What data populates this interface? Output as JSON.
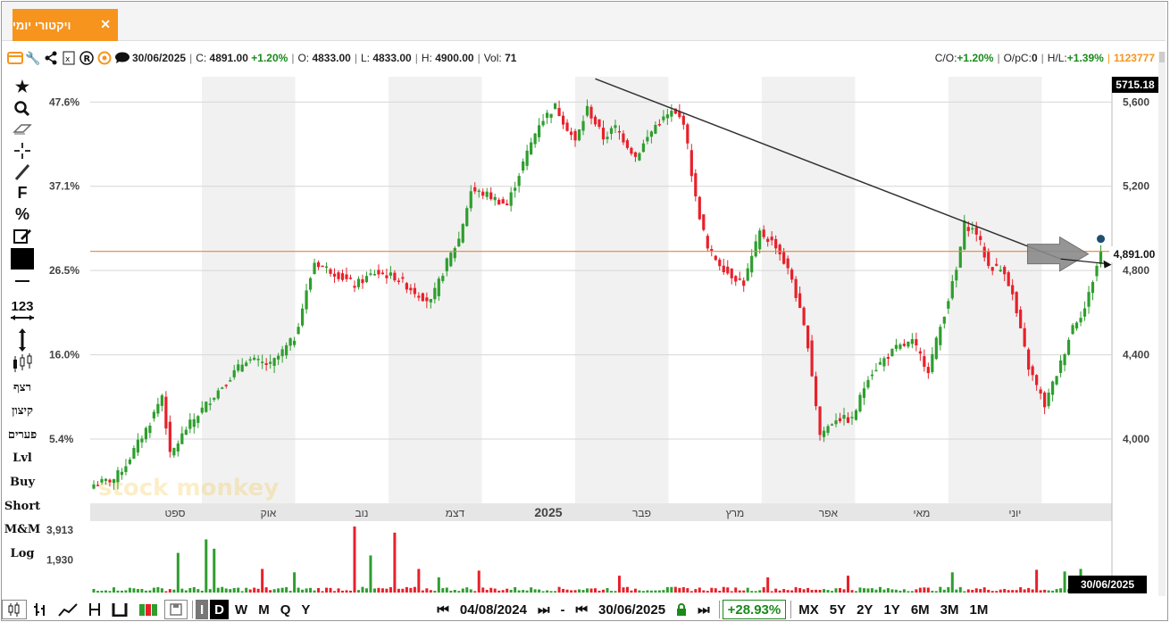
{
  "tab": {
    "name": "ויקטורי יומי",
    "close": "✕"
  },
  "info": {
    "date": "30/06/2025",
    "close_label": "C:",
    "close": "4891.00",
    "change": "+1.20%",
    "open_label": "O:",
    "open": "4833.00",
    "low_label": "L:",
    "low": "4833.00",
    "high_label": "H:",
    "high": "4900.00",
    "vol_label": "Vol:",
    "vol": "71",
    "co_label": "C/O:",
    "co": "+1.20%",
    "opc_label": "O/pC:",
    "opc": "0",
    "hl_label": "H/L:",
    "hl": "+1.39%",
    "id": "1123777"
  },
  "sidebar": {
    "tools": [
      "★",
      "🔍",
      "⌫",
      "┼",
      "╱",
      "F",
      "%",
      "✎"
    ],
    "labels": [
      "123",
      "רצף",
      "קיצון",
      "פערים",
      "Lvl",
      "Buy",
      "Short",
      "M&M",
      "Log"
    ]
  },
  "badges": {
    "last": "5715.18",
    "price": "4,891.00",
    "date": "30/06/2025"
  },
  "bottom": {
    "buttons": [
      "I",
      "D",
      "W",
      "M",
      "Q",
      "Y"
    ],
    "from_date": "04/08/2024",
    "dash": "-",
    "to_date": "30/06/2025",
    "return": "+28.93%",
    "ranges": [
      "MX",
      "5Y",
      "2Y",
      "1Y",
      "6M",
      "3M",
      "1M"
    ]
  },
  "colors": {
    "up": "#2e9e2e",
    "down": "#e8202a",
    "accent": "#f7941d",
    "trend": "#333333",
    "hline": "#e08a3a"
  },
  "watermark": "stock monkey",
  "chart_data": {
    "type": "candlestick",
    "x_range": [
      "04/08/2024",
      "30/06/2025"
    ],
    "month_labels": [
      "ספט",
      "אוק",
      "נוב",
      "דצמ",
      "2025",
      "פבר",
      "מרץ",
      "אפר",
      "מאי",
      "יוני"
    ],
    "price_axis": {
      "ticks": [
        5600,
        5200,
        4800,
        4400,
        4000
      ],
      "tick_labels": [
        "5,600",
        "5,200",
        "4,800",
        "4,400",
        "4,000"
      ],
      "range": [
        3695,
        5720
      ]
    },
    "pct_axis": {
      "tick_labels": [
        "47.6%",
        "37.1%",
        "26.5%",
        "16.0%",
        "5.4%"
      ]
    },
    "volume_axis": {
      "tick_labels": [
        "3,913",
        "1,930"
      ],
      "max": 3913
    },
    "last_price": 4891,
    "hline": 4891,
    "trendline": {
      "from": {
        "index": 125,
        "price": 5710
      },
      "to": {
        "index": 241,
        "price": 4855
      }
    },
    "anchors": [
      [
        0,
        3785
      ],
      [
        5,
        3810
      ],
      [
        8,
        3880
      ],
      [
        14,
        4080
      ],
      [
        17,
        4210
      ],
      [
        19,
        3920
      ],
      [
        23,
        4050
      ],
      [
        30,
        4210
      ],
      [
        38,
        4380
      ],
      [
        44,
        4350
      ],
      [
        50,
        4480
      ],
      [
        55,
        4840
      ],
      [
        60,
        4790
      ],
      [
        65,
        4730
      ],
      [
        70,
        4790
      ],
      [
        75,
        4770
      ],
      [
        80,
        4700
      ],
      [
        84,
        4650
      ],
      [
        88,
        4840
      ],
      [
        91,
        4950
      ],
      [
        94,
        5180
      ],
      [
        98,
        5160
      ],
      [
        103,
        5110
      ],
      [
        107,
        5310
      ],
      [
        111,
        5500
      ],
      [
        115,
        5580
      ],
      [
        120,
        5410
      ],
      [
        123,
        5570
      ],
      [
        127,
        5430
      ],
      [
        130,
        5480
      ],
      [
        135,
        5340
      ],
      [
        140,
        5490
      ],
      [
        144,
        5550
      ],
      [
        147,
        5510
      ],
      [
        150,
        5140
      ],
      [
        153,
        4900
      ],
      [
        158,
        4790
      ],
      [
        162,
        4740
      ],
      [
        166,
        4980
      ],
      [
        170,
        4920
      ],
      [
        174,
        4760
      ],
      [
        178,
        4450
      ],
      [
        181,
        4020
      ],
      [
        185,
        4100
      ],
      [
        189,
        4090
      ],
      [
        193,
        4300
      ],
      [
        197,
        4380
      ],
      [
        200,
        4430
      ],
      [
        204,
        4460
      ],
      [
        208,
        4330
      ],
      [
        212,
        4600
      ],
      [
        215,
        4800
      ],
      [
        217,
        5020
      ],
      [
        220,
        4980
      ],
      [
        223,
        4820
      ],
      [
        227,
        4800
      ],
      [
        229,
        4680
      ],
      [
        233,
        4340
      ],
      [
        237,
        4160
      ],
      [
        241,
        4360
      ],
      [
        244,
        4540
      ],
      [
        247,
        4620
      ],
      [
        251,
        4891
      ]
    ],
    "volume": [
      {
        "index": 21,
        "value": 2350
      },
      {
        "index": 28,
        "value": 3150
      },
      {
        "index": 30,
        "value": 2600
      },
      {
        "index": 42,
        "value": 1400
      },
      {
        "index": 50,
        "value": 1200
      },
      {
        "index": 65,
        "value": 3913
      },
      {
        "index": 69,
        "value": 2200
      },
      {
        "index": 75,
        "value": 3550
      },
      {
        "index": 81,
        "value": 1400
      },
      {
        "index": 86,
        "value": 900
      },
      {
        "index": 96,
        "value": 1300
      },
      {
        "index": 131,
        "value": 1000
      },
      {
        "index": 168,
        "value": 900
      },
      {
        "index": 188,
        "value": 1000
      },
      {
        "index": 214,
        "value": 1200
      },
      {
        "index": 235,
        "value": 1350
      },
      {
        "index": 242,
        "value": 1250
      },
      {
        "index": 246,
        "value": 1400
      }
    ]
  }
}
